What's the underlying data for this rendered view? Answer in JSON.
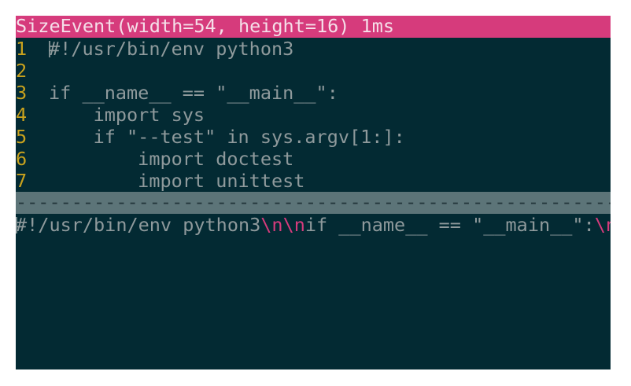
{
  "status_bar": {
    "text": "SizeEvent(width=54, height=16) 1ms"
  },
  "editor": {
    "lines": [
      {
        "num": "1",
        "text": "#!/usr/bin/env python3"
      },
      {
        "num": "2",
        "text": ""
      },
      {
        "num": "3",
        "text": "if __name__ == \"__main__\":"
      },
      {
        "num": "4",
        "text": "    import sys"
      },
      {
        "num": "5",
        "text": "    if \"--test\" in sys.argv[1:]:"
      },
      {
        "num": "6",
        "text": "        import doctest"
      },
      {
        "num": "7",
        "text": "        import unittest"
      }
    ]
  },
  "divider": {
    "text": "------------------------------------------------------"
  },
  "preview": {
    "part1": "#!/usr/bin/env python3",
    "esc1": "\\n",
    "esc2": "\\n",
    "part2": "if __name__ == \"__main__\":",
    "esc3": "\\n"
  },
  "colors": {
    "terminal_bg": "#032a33",
    "status_bg": "#d63b7c",
    "line_number": "#c9a21d",
    "code_text": "#8f9a9c",
    "escape": "#d63b7c",
    "divider_bg": "#5c7478"
  }
}
